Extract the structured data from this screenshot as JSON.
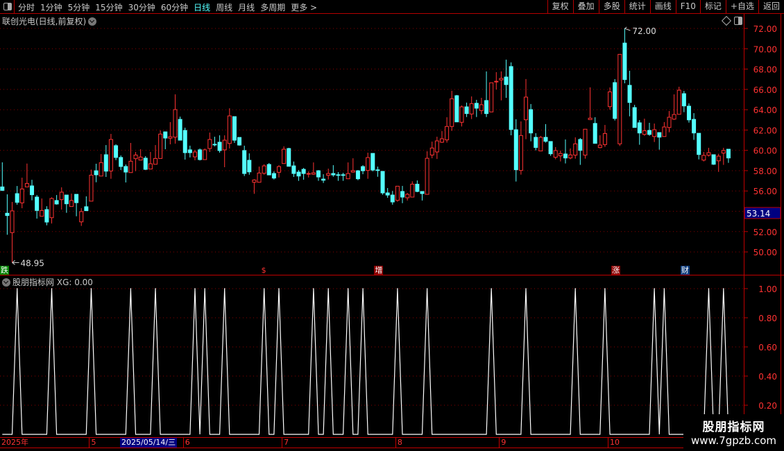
{
  "toolbar": {
    "periods": [
      "分时",
      "1分钟",
      "5分钟",
      "15分钟",
      "30分钟",
      "60分钟",
      "日线",
      "周线",
      "月线",
      "多周期",
      "更多 >"
    ],
    "active_period": "日线",
    "buttons": [
      "复权",
      "叠加",
      "多股",
      "统计",
      "画线",
      "F10",
      "标记",
      "+自选",
      "返回"
    ]
  },
  "main_chart": {
    "title": "联创光电(日线,前复权)",
    "high_label": "72.00",
    "low_label": "48.95",
    "cursor_price": "53.14",
    "price_ticks": [
      "72.00",
      "70.00",
      "68.00",
      "66.00",
      "64.00",
      "62.00",
      "60.00",
      "58.00",
      "56.00",
      "54.00",
      "52.00",
      "50.00"
    ],
    "signals": [
      {
        "text": "跌",
        "bg": "#008000",
        "bar": 0
      },
      {
        "text": "$",
        "bg": "transparent",
        "bar": 53
      },
      {
        "text": "增",
        "bg": "#8b0000",
        "bar": 76
      },
      {
        "text": "涨",
        "bg": "#8b0000",
        "bar": 124
      },
      {
        "text": "财",
        "bg": "#0a3a7a",
        "bar": 138
      }
    ]
  },
  "indicator": {
    "title": "股朋指标网",
    "value_label": "XG: 0.00",
    "ticks": [
      "1.00",
      "0.80",
      "0.60",
      "0.40",
      "0.20"
    ]
  },
  "date_axis": {
    "labels": [
      {
        "text": "2025年",
        "bar": 0
      },
      {
        "text": "5",
        "bar": 18
      },
      {
        "text": "6",
        "bar": 37
      },
      {
        "text": "7",
        "bar": 57
      },
      {
        "text": "8",
        "bar": 80
      },
      {
        "text": "9",
        "bar": 101
      },
      {
        "text": "10",
        "bar": 123
      }
    ],
    "cursor_date": "2025/05/14/三"
  },
  "watermark": {
    "line1": "股朋指标网",
    "line2": "www.7gpzb.com"
  },
  "colors": {
    "up": "#ff3232",
    "down": "#54ffff",
    "grid": "#8b0000",
    "axis": "#c00000",
    "accent": "#54ffff"
  },
  "chart_data": [
    {
      "type": "candlestick",
      "ylim": [
        48,
        72
      ],
      "fields": [
        "open",
        "high",
        "low",
        "close"
      ],
      "candles": [
        [
          56.4,
          58.82,
          56.0,
          56.06
        ],
        [
          53.81,
          55.67,
          51.69,
          53.58
        ],
        [
          51.9,
          54.92,
          48.95,
          54.04
        ],
        [
          55.74,
          56.49,
          54.65,
          54.88
        ],
        [
          54.83,
          57.31,
          54.3,
          56.2
        ],
        [
          56.4,
          58.7,
          56.4,
          56.74
        ],
        [
          56.5,
          57.1,
          55.08,
          55.63
        ],
        [
          55.4,
          55.6,
          53.28,
          54.08
        ],
        [
          53.51,
          55.26,
          53.5,
          54.08
        ],
        [
          54.17,
          54.5,
          52.62,
          52.94
        ],
        [
          53.37,
          55.38,
          52.8,
          55.26
        ],
        [
          55.06,
          55.6,
          54.65,
          54.72
        ],
        [
          55.15,
          56.36,
          54.17,
          55.88
        ],
        [
          55.6,
          55.6,
          53.85,
          54.74
        ],
        [
          54.47,
          55.74,
          54.47,
          55.06
        ],
        [
          55.67,
          55.67,
          53.51,
          54.85
        ],
        [
          52.96,
          54.31,
          52.56,
          53.97
        ],
        [
          54.45,
          55.47,
          54.06,
          54.06
        ],
        [
          55.0,
          58.1,
          55.0,
          57.56
        ],
        [
          57.99,
          58.68,
          56.86,
          57.59
        ],
        [
          57.47,
          59.64,
          57.47,
          58.79
        ],
        [
          59.57,
          60.52,
          57.38,
          57.95
        ],
        [
          57.97,
          61.62,
          57.2,
          61.07
        ],
        [
          60.46,
          60.6,
          59.04,
          59.3
        ],
        [
          59.3,
          59.5,
          58.06,
          58.41
        ],
        [
          58.41,
          58.61,
          56.84,
          57.86
        ],
        [
          57.81,
          60.73,
          57.81,
          58.93
        ],
        [
          59.18,
          59.84,
          57.95,
          59.54
        ],
        [
          59.04,
          60.11,
          59.04,
          59.34
        ],
        [
          59.23,
          59.43,
          58.06,
          58.13
        ],
        [
          58.16,
          59.84,
          58.16,
          58.68
        ],
        [
          58.63,
          60.52,
          58.63,
          59.2
        ],
        [
          59.2,
          61.96,
          59.2,
          61.6
        ],
        [
          61.82,
          61.82,
          60.11,
          61.21
        ],
        [
          61.19,
          62.78,
          60.59,
          61.34
        ],
        [
          61.3,
          65.51,
          60.66,
          64.01
        ],
        [
          63.05,
          63.32,
          61.0,
          61.0
        ],
        [
          61.96,
          62.23,
          59.09,
          59.77
        ],
        [
          60.05,
          60.46,
          59.3,
          59.77
        ],
        [
          59.36,
          60.05,
          59.02,
          59.84
        ],
        [
          60.05,
          60.18,
          59.0,
          59.09
        ],
        [
          59.09,
          60.18,
          59.09,
          60.05
        ],
        [
          60.18,
          61.75,
          59.84,
          61.07
        ],
        [
          60.6,
          61.34,
          60.39,
          60.56
        ],
        [
          60.8,
          61.48,
          59.77,
          59.98
        ],
        [
          60.05,
          61.48,
          58.34,
          61.0
        ],
        [
          60.68,
          64.14,
          60.18,
          63.39
        ],
        [
          63.32,
          63.32,
          60.73,
          61.0
        ],
        [
          61.27,
          61.27,
          60.46,
          60.52
        ],
        [
          59.98,
          60.46,
          57.47,
          57.72
        ],
        [
          59.02,
          59.7,
          57.6,
          57.88
        ],
        [
          56.86,
          57.15,
          55.72,
          57.08
        ],
        [
          56.86,
          58.4,
          56.86,
          57.77
        ],
        [
          57.74,
          58.63,
          57.6,
          58.47
        ],
        [
          58.61,
          58.75,
          57.58,
          57.58
        ],
        [
          57.72,
          57.93,
          57.13,
          57.27
        ],
        [
          57.84,
          58.54,
          57.33,
          58.4
        ],
        [
          58.7,
          60.39,
          58.7,
          60.11
        ],
        [
          60.18,
          60.25,
          58.43,
          58.43
        ],
        [
          58.47,
          58.9,
          57.38,
          57.72
        ],
        [
          57.86,
          58.06,
          57.0,
          57.47
        ],
        [
          58.13,
          58.27,
          57.11,
          57.72
        ],
        [
          57.72,
          57.93,
          57.33,
          57.72
        ],
        [
          57.65,
          58.81,
          57.58,
          57.79
        ],
        [
          57.99,
          58.06,
          57.0,
          57.38
        ],
        [
          57.17,
          57.65,
          56.79,
          57.06
        ],
        [
          57.54,
          58.2,
          57.13,
          57.72
        ],
        [
          57.72,
          58.54,
          57.4,
          57.58
        ],
        [
          57.6,
          57.86,
          57.0,
          57.58
        ],
        [
          57.6,
          57.79,
          57.0,
          57.58
        ],
        [
          57.2,
          58.81,
          57.2,
          57.72
        ],
        [
          57.86,
          59.22,
          57.8,
          58.0
        ],
        [
          57.99,
          58.06,
          57.06,
          57.2
        ],
        [
          58.4,
          58.54,
          57.65,
          57.99
        ],
        [
          58.02,
          59.77,
          57.2,
          59.29
        ],
        [
          59.7,
          59.7,
          57.93,
          58.06
        ],
        [
          58.08,
          58.4,
          57.4,
          58.06
        ],
        [
          57.93,
          57.93,
          55.63,
          55.81
        ],
        [
          55.81,
          56.29,
          55.33,
          55.6
        ],
        [
          55.6,
          56.0,
          54.65,
          54.92
        ],
        [
          55.08,
          56.47,
          54.94,
          56.47
        ],
        [
          55.95,
          56.5,
          54.8,
          55.4
        ],
        [
          55.33,
          55.81,
          55.06,
          55.67
        ],
        [
          55.4,
          56.95,
          55.4,
          56.67
        ],
        [
          56.67,
          57.04,
          55.88,
          55.95
        ],
        [
          55.95,
          55.95,
          55.06,
          55.74
        ],
        [
          55.67,
          59.91,
          55.67,
          59.22
        ],
        [
          59.54,
          60.86,
          59.22,
          60.23
        ],
        [
          59.84,
          61.34,
          59.15,
          60.93
        ],
        [
          60.8,
          61.9,
          60.73,
          61.14
        ],
        [
          61.03,
          63.26,
          60.76,
          62.35
        ],
        [
          62.35,
          65.86,
          61.92,
          65.08
        ],
        [
          65.38,
          65.45,
          62.8,
          62.8
        ],
        [
          62.76,
          64.42,
          62.35,
          64.28
        ],
        [
          64.28,
          64.7,
          63.28,
          63.62
        ],
        [
          63.58,
          65.31,
          63.08,
          64.6
        ],
        [
          64.63,
          64.97,
          63.28,
          64.15
        ],
        [
          63.92,
          65.17,
          63.56,
          64.49
        ],
        [
          64.9,
          67.77,
          63.28,
          63.62
        ],
        [
          63.78,
          66.65,
          63.78,
          66.65
        ],
        [
          66.78,
          67.7,
          65.99,
          66.8
        ],
        [
          66.93,
          67.77,
          64.92,
          67.08
        ],
        [
          67.22,
          68.93,
          65.17,
          66.47
        ],
        [
          68.25,
          68.66,
          61.48,
          62.05
        ],
        [
          62.03,
          63.06,
          56.93,
          58.09
        ],
        [
          58.02,
          62.85,
          57.61,
          61.46
        ],
        [
          63.01,
          67.02,
          61.1,
          65.24
        ],
        [
          64.01,
          64.56,
          60.89,
          61.71
        ],
        [
          61.28,
          61.69,
          60.0,
          60.28
        ],
        [
          59.94,
          61.42,
          59.94,
          61.28
        ],
        [
          61.28,
          62.58,
          60.76,
          60.89
        ],
        [
          60.87,
          60.87,
          59.46,
          59.66
        ],
        [
          59.32,
          60.32,
          59.12,
          59.98
        ],
        [
          59.46,
          59.98,
          58.91,
          59.69
        ],
        [
          59.64,
          61.07,
          58.71,
          59.25
        ],
        [
          59.25,
          60.19,
          59.12,
          59.55
        ],
        [
          59.53,
          61.28,
          59.18,
          60.64
        ],
        [
          61.07,
          61.21,
          58.57,
          60.0
        ],
        [
          59.53,
          62.08,
          59.18,
          62.08
        ],
        [
          63.03,
          66.2,
          63.03,
          63.17
        ],
        [
          62.65,
          63.26,
          60.69,
          60.69
        ],
        [
          60.27,
          61.48,
          60.2,
          60.52
        ],
        [
          60.57,
          62.5,
          60.34,
          61.66
        ],
        [
          64.3,
          66.19,
          64.0,
          65.76
        ],
        [
          66.67,
          67.01,
          62.94,
          63.14
        ],
        [
          60.64,
          69.45,
          60.43,
          69.45
        ],
        [
          70.56,
          72.0,
          66.6,
          66.97
        ],
        [
          66.4,
          67.83,
          63.35,
          64.71
        ],
        [
          64.21,
          64.48,
          62.25,
          62.25
        ],
        [
          62.71,
          62.98,
          60.55,
          61.71
        ],
        [
          61.57,
          63.12,
          61.43,
          61.93
        ],
        [
          61.96,
          62.71,
          61.43,
          61.57
        ],
        [
          61.36,
          62.64,
          60.82,
          62.03
        ],
        [
          61.75,
          61.75,
          60.07,
          61.3
        ],
        [
          61.36,
          62.78,
          61.36,
          62.3
        ],
        [
          62.25,
          63.87,
          61.78,
          63.26
        ],
        [
          63.07,
          65.51,
          63.0,
          63.53
        ],
        [
          63.55,
          66.26,
          63.55,
          65.92
        ],
        [
          65.58,
          65.85,
          63.76,
          64.37
        ],
        [
          64.35,
          64.62,
          62.73,
          63.0
        ],
        [
          63.05,
          63.66,
          61.03,
          61.71
        ],
        [
          61.68,
          61.68,
          59.11,
          59.59
        ],
        [
          59.04,
          59.84,
          58.91,
          59.5
        ],
        [
          59.52,
          60.25,
          59.39,
          59.77
        ],
        [
          59.57,
          59.57,
          58.57,
          58.63
        ],
        [
          58.97,
          59.66,
          57.88,
          59.43
        ],
        [
          59.73,
          60.25,
          58.57,
          59.98
        ],
        [
          60.11,
          60.11,
          58.77,
          59.25
        ]
      ]
    },
    {
      "type": "line",
      "series_name": "XG",
      "ylim": [
        0,
        1
      ],
      "baseline": 0,
      "signal_value": 1,
      "signal_bars": [
        3,
        10,
        18,
        26,
        31,
        39,
        41,
        45,
        53,
        56,
        63,
        66,
        70,
        73,
        80,
        86,
        99,
        106,
        116,
        122,
        132,
        134,
        143,
        146
      ]
    }
  ]
}
